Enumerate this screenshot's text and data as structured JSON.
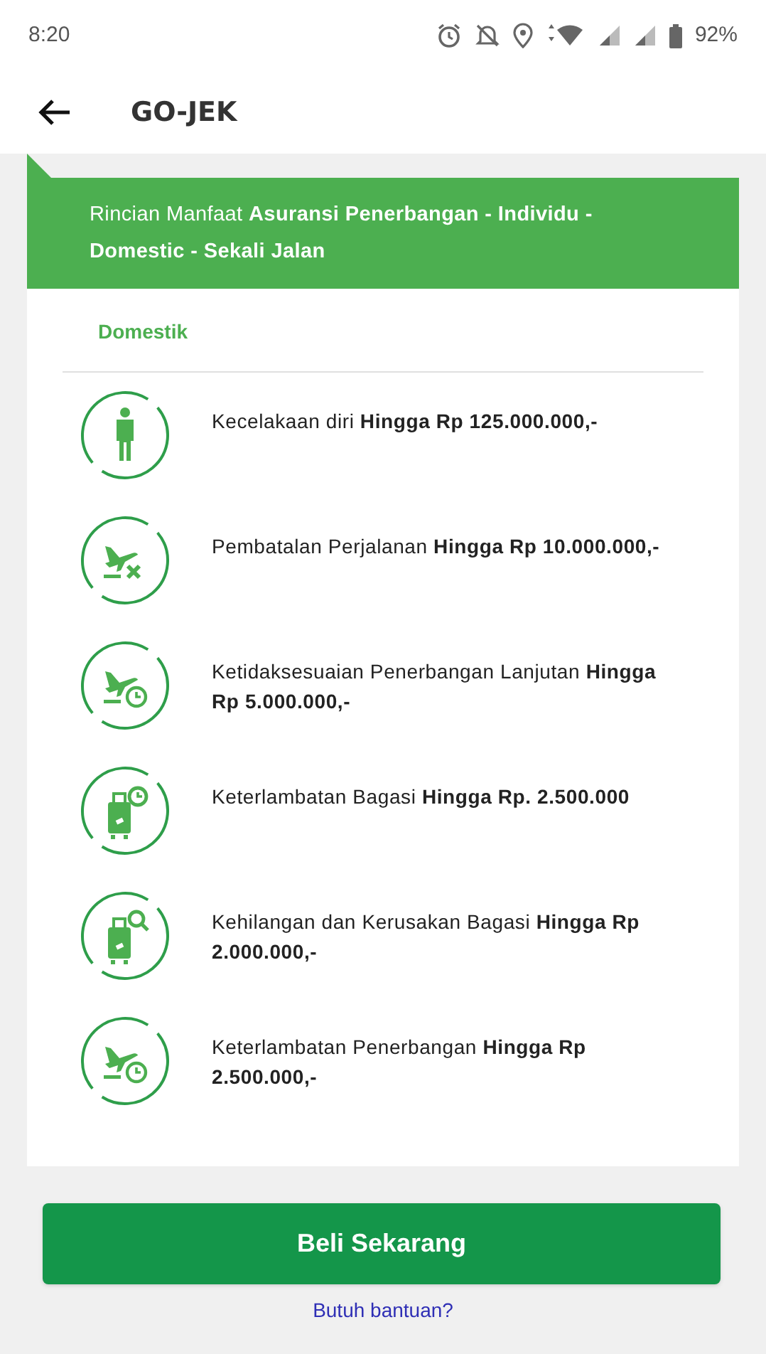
{
  "status_bar": {
    "time": "8:20",
    "battery": "92%"
  },
  "app_bar": {
    "title": "GO-JEK"
  },
  "banner": {
    "text": "Rincian Manfaat **Asuransi Penerbangan - Individu - Domestic - Sekali Jalan**"
  },
  "section": {
    "title": "Domestik"
  },
  "benefits": [
    {
      "kind": "person",
      "text": "Kecelakaan diri **Hingga Rp 125.000.000,-**"
    },
    {
      "kind": "plane-cancel",
      "text": "Pembatalan Perjalanan **Hingga Rp 10.000.000,-**"
    },
    {
      "kind": "plane-clock",
      "text": "Ketidaksesuaian Penerbangan Lanjutan **Hingga Rp 5.000.000,-**"
    },
    {
      "kind": "luggage-clock",
      "text": "Keterlambatan Bagasi **Hingga Rp. 2.500.000**"
    },
    {
      "kind": "luggage-search",
      "text": "Kehilangan dan Kerusakan Bagasi **Hingga Rp 2.000.000,-**"
    },
    {
      "kind": "plane-clock",
      "text": "Keterlambatan Penerbangan **Hingga Rp 2.500.000,-**"
    }
  ],
  "buy_button": {
    "label": "Beli Sekarang"
  },
  "help_link": {
    "label": "Butuh bantuan?"
  }
}
